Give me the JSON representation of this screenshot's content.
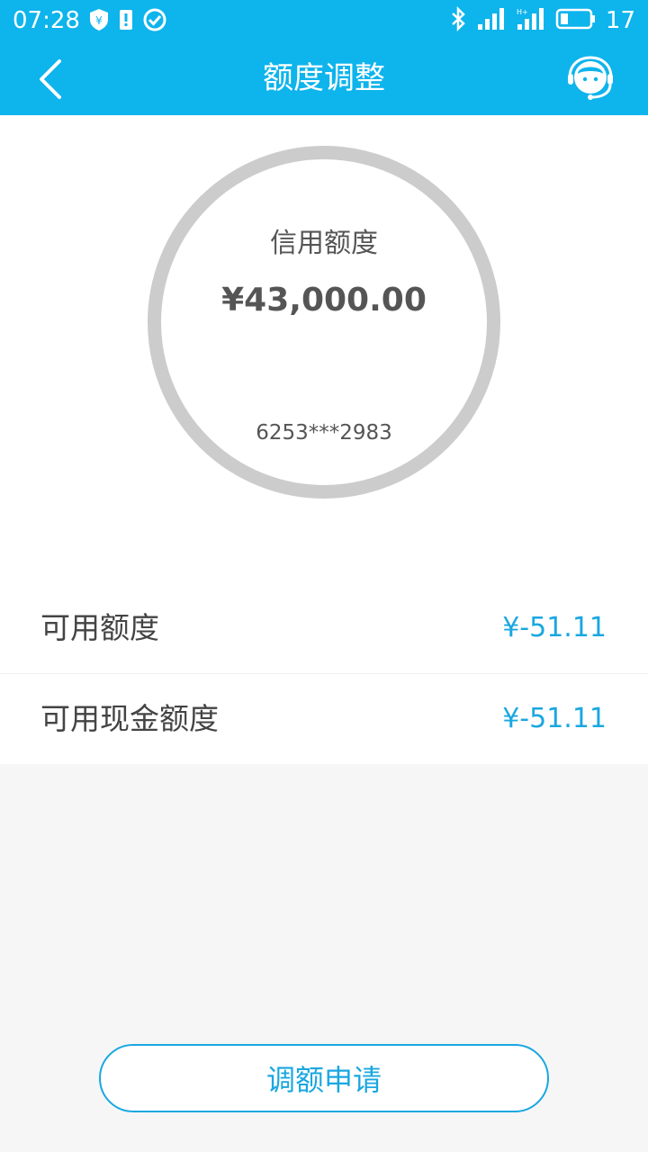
{
  "status_bar": {
    "time": "07:28",
    "battery_level": "17",
    "icons": [
      "shield-yen-icon",
      "alert-icon",
      "check-circle-icon",
      "bluetooth-icon",
      "signal-icon",
      "signal-hplus-icon",
      "battery-icon"
    ]
  },
  "header": {
    "title": "额度调整",
    "back_icon": "chevron-left-icon",
    "service_icon": "customer-service-icon",
    "bg_color": "#0eb4ec"
  },
  "credit": {
    "label": "信用额度",
    "amount": "¥43,000.00",
    "card_number": "6253***2983"
  },
  "limits": [
    {
      "label": "可用额度",
      "value": "¥-51.11"
    },
    {
      "label": "可用现金额度",
      "value": "¥-51.11"
    }
  ],
  "action": {
    "apply_label": "调额申请"
  },
  "colors": {
    "accent": "#1aa7e0",
    "ring": "#cccccc"
  }
}
